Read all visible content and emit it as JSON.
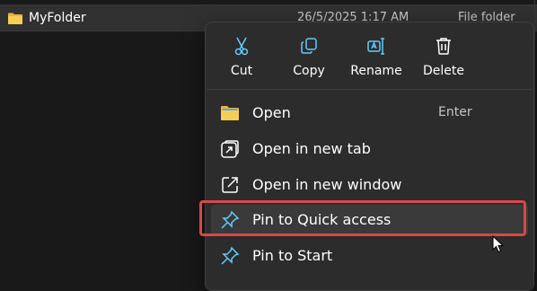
{
  "file": {
    "name": "MyFolder",
    "date": "26/5/2025 1:17 AM",
    "type": "File folder",
    "icon": "folder-icon"
  },
  "menu": {
    "toolbar": [
      {
        "label": "Cut",
        "icon": "scissors-icon"
      },
      {
        "label": "Copy",
        "icon": "copy-icon"
      },
      {
        "label": "Rename",
        "icon": "rename-icon"
      },
      {
        "label": "Delete",
        "icon": "trash-icon"
      }
    ],
    "items": [
      {
        "label": "Open",
        "shortcut": "Enter",
        "icon": "folder-icon"
      },
      {
        "label": "Open in new tab",
        "icon": "new-tab-icon"
      },
      {
        "label": "Open in new window",
        "icon": "new-window-icon"
      },
      {
        "label": "Pin to Quick access",
        "icon": "pin-icon",
        "highlighted": true
      },
      {
        "label": "Pin to Start",
        "icon": "pin-icon"
      }
    ]
  },
  "colors": {
    "accent": "#60cdff",
    "highlight_border": "#d84848",
    "folder": "#f4c542",
    "menu_bg": "#2c2c2c"
  }
}
